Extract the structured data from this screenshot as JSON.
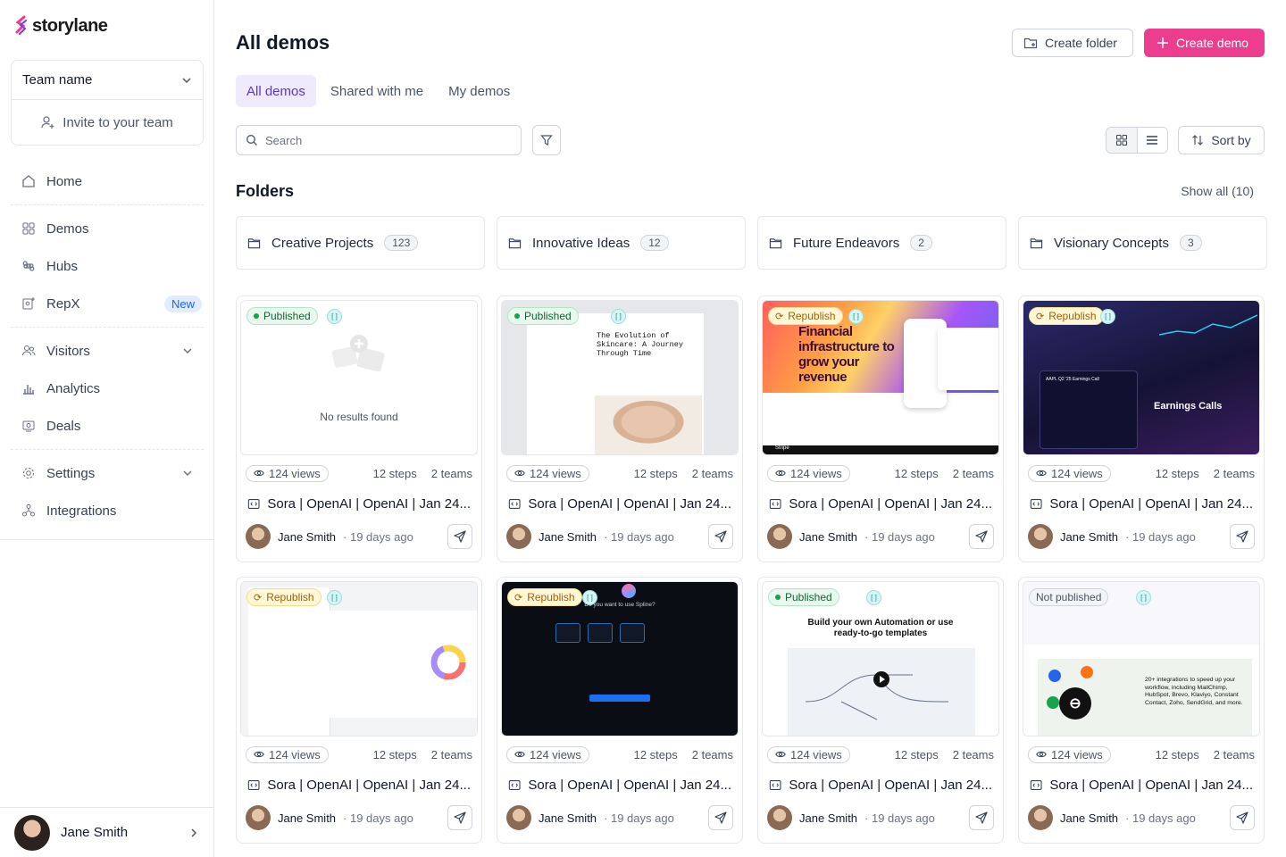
{
  "brand": {
    "name": "storylane",
    "accent": "#ec3d8e",
    "purple": "#5b35d5"
  },
  "team": {
    "name": "Team name",
    "invite_label": "Invite to your team"
  },
  "nav": {
    "home": "Home",
    "demos": "Demos",
    "hubs": "Hubs",
    "repx": "RepX",
    "repx_badge": "New",
    "visitors": "Visitors",
    "analytics": "Analytics",
    "deals": "Deals",
    "settings": "Settings",
    "integrations": "Integrations"
  },
  "user": {
    "name": "Jane Smith"
  },
  "header": {
    "title": "All demos",
    "create_folder": "Create folder",
    "create_demo": "Create demo"
  },
  "tabs": [
    "All demos",
    "Shared with me",
    "My demos"
  ],
  "search": {
    "placeholder": "Search"
  },
  "sort": {
    "label": "Sort by"
  },
  "folders_section": {
    "title": "Folders",
    "show_all": "Show all (10)",
    "items": [
      {
        "name": "Creative Projects",
        "count": "123"
      },
      {
        "name": "Innovative Ideas",
        "count": "12"
      },
      {
        "name": "Future Endeavors",
        "count": "2"
      },
      {
        "name": "Visionary Concepts",
        "count": "3"
      }
    ]
  },
  "empty_thumb_text": "No results found",
  "thumb_texts": {
    "skincare": "The Evolution of Skincare: A Journey Through Time",
    "stripe": "Financial infrastructure to grow your revenue",
    "stripe_footer": "Stripe",
    "earnings": "Earnings Calls",
    "earnings_sub": "AAPL Q2 '25 Earnings Call",
    "spline": "Do you want to use Spline?",
    "automation": "Build your own Automation or use ready-to-go templates",
    "integrations": "20+ integrations to speed up your workflow, including MailChimp, HubSpot, Brevo, Klaviyo, Constant Contact, Zoho, SendGrid, and more."
  },
  "cards": [
    {
      "status": "Published",
      "views": "124 views",
      "steps": "12 steps",
      "teams": "2 teams",
      "title": "Sora | OpenAI | OpenAI | Jan 24...",
      "author": "Jane Smith",
      "ago": "· 19 days ago"
    },
    {
      "status": "Published",
      "views": "124 views",
      "steps": "12 steps",
      "teams": "2 teams",
      "title": "Sora | OpenAI | OpenAI | Jan 24...",
      "author": "Jane Smith",
      "ago": "· 19 days ago"
    },
    {
      "status": "Republish",
      "views": "124 views",
      "steps": "12 steps",
      "teams": "2 teams",
      "title": "Sora | OpenAI | OpenAI | Jan 24...",
      "author": "Jane Smith",
      "ago": "· 19 days ago"
    },
    {
      "status": "Republish",
      "views": "124 views",
      "steps": "12 steps",
      "teams": "2 teams",
      "title": "Sora | OpenAI | OpenAI | Jan 24...",
      "author": "Jane Smith",
      "ago": "· 19 days ago"
    },
    {
      "status": "Republish",
      "views": "124 views",
      "steps": "12 steps",
      "teams": "2 teams",
      "title": "Sora | OpenAI | OpenAI | Jan 24...",
      "author": "Jane Smith",
      "ago": "· 19 days ago"
    },
    {
      "status": "Republish",
      "views": "124 views",
      "steps": "12 steps",
      "teams": "2 teams",
      "title": "Sora | OpenAI | OpenAI | Jan 24...",
      "author": "Jane Smith",
      "ago": "· 19 days ago"
    },
    {
      "status": "Published",
      "views": "124 views",
      "steps": "12 steps",
      "teams": "2 teams",
      "title": "Sora | OpenAI | OpenAI | Jan 24...",
      "author": "Jane Smith",
      "ago": "· 19 days ago"
    },
    {
      "status": "Not published",
      "views": "124 views",
      "steps": "12 steps",
      "teams": "2 teams",
      "title": "Sora | OpenAI | OpenAI | Jan 24...",
      "author": "Jane Smith",
      "ago": "· 19 days ago"
    }
  ]
}
